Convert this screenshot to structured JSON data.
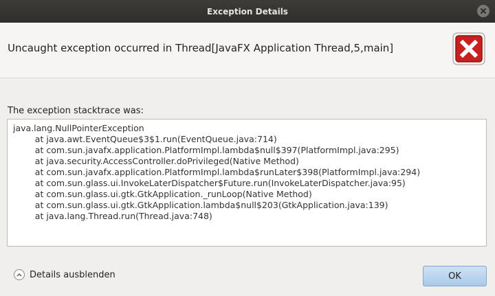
{
  "window": {
    "title": "Exception Details",
    "close_icon": "close-icon"
  },
  "header": {
    "message": "Uncaught exception occurred in Thread[JavaFX Application Thread,5,main]",
    "icon": "error-x-icon"
  },
  "trace": {
    "label": "The exception stacktrace was:",
    "lines": [
      "java.lang.NullPointerException",
      "        at java.awt.EventQueue$3$1.run(EventQueue.java:714)",
      "        at com.sun.javafx.application.PlatformImpl.lambda$null$397(PlatformImpl.java:295)",
      "        at java.security.AccessController.doPrivileged(Native Method)",
      "        at com.sun.javafx.application.PlatformImpl.lambda$runLater$398(PlatformImpl.java:294)",
      "        at com.sun.glass.ui.InvokeLaterDispatcher$Future.run(InvokeLaterDispatcher.java:95)",
      "        at com.sun.glass.ui.gtk.GtkApplication._runLoop(Native Method)",
      "        at com.sun.glass.ui.gtk.GtkApplication.lambda$null$203(GtkApplication.java:139)",
      "        at java.lang.Thread.run(Thread.java:748)"
    ]
  },
  "footer": {
    "details_label": "Details ausblenden",
    "details_icon": "chevron-up-icon",
    "ok_label": "OK"
  },
  "colors": {
    "titlebar": "#2f2e2b",
    "error_red": "#c8201f",
    "ok_button": "#a9c9e8"
  }
}
